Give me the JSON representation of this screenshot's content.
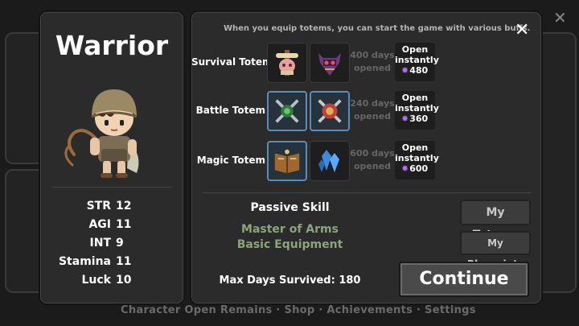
{
  "background": {
    "footer_text": "Character  Open Remains  ·  Shop  ·  Achievements  ·  Settings"
  },
  "character": {
    "class_name": "Warrior",
    "stats": [
      {
        "name": "STR",
        "value": "12"
      },
      {
        "name": "AGI",
        "value": "11"
      },
      {
        "name": "INT",
        "value": "9"
      },
      {
        "name": "Stamina",
        "value": "11"
      },
      {
        "name": "Luck",
        "value": "10"
      }
    ]
  },
  "totems": {
    "notice": "When you equip totems, you can start the game with various buffs.",
    "close_icon": "close-icon",
    "rows": [
      {
        "label": "Survival Totem",
        "days_line1": "400 days",
        "days_line2": "opened",
        "open_line1": "Open",
        "open_line2": "instantly",
        "cost": "480",
        "icons": [
          "skull-totem-icon",
          "demon-mask-totem-icon"
        ]
      },
      {
        "label": "Battle Totem",
        "days_line1": "240 days",
        "days_line2": "opened",
        "open_line1": "Open",
        "open_line2": "instantly",
        "cost": "360",
        "icons": [
          "crossed-swords-totem-icon",
          "crossed-blades-totem-icon"
        ]
      },
      {
        "label": "Magic Totem",
        "days_line1": "600 days",
        "days_line2": "opened",
        "open_line1": "Open",
        "open_line2": "instantly",
        "cost": "600",
        "icons": [
          "spellbook-totem-icon",
          "blue-crystal-totem-icon"
        ]
      }
    ]
  },
  "passive": {
    "title": "Passive Skill",
    "items": [
      "Master of Arms",
      "Basic Equipment"
    ]
  },
  "max_days": "Max Days Survived: 180",
  "buttons": {
    "my_totems": "My Totems",
    "my_blueprints": "My Blueprints",
    "continue": "Continue"
  },
  "colors": {
    "skill_text": "#8fa27e",
    "gem": "#b26bff",
    "selected_border": "#5b8db8"
  }
}
